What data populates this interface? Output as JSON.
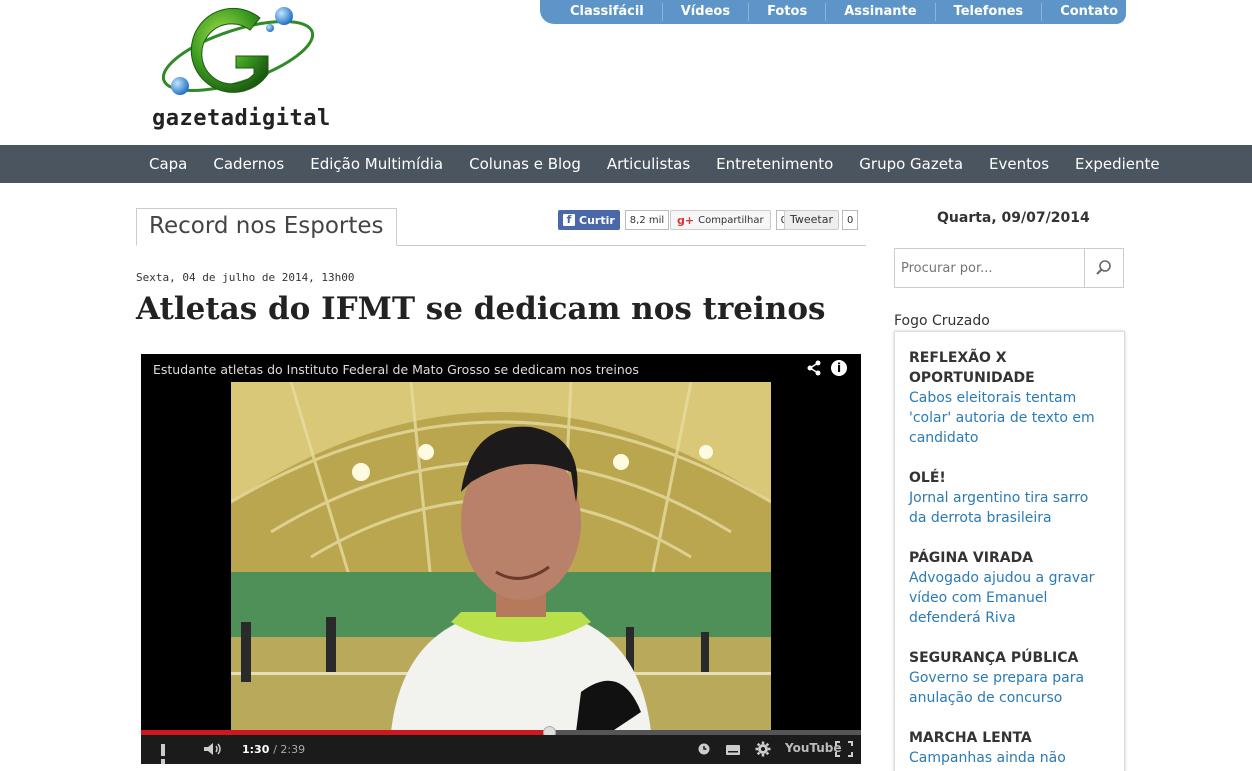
{
  "logo": {
    "text": "gazetadigital"
  },
  "top_menu": [
    "Classifácil",
    "Vídeos",
    "Fotos",
    "Assinante",
    "Telefones",
    "Contato"
  ],
  "main_nav": [
    "Capa",
    "Cadernos",
    "Edição Multimídia",
    "Colunas e Blog",
    "Articulistas",
    "Entretenimento",
    "Grupo Gazeta",
    "Eventos",
    "Expediente"
  ],
  "section": {
    "title": "Record nos Esportes"
  },
  "social": {
    "facebook_label": "Curtir",
    "facebook_count": "8,2 mil",
    "gplus_label": "Compartilhar",
    "gplus_count": "0",
    "twitter_label": "Tweetar",
    "twitter_count": "0"
  },
  "article": {
    "date": "Sexta, 04 de julho de 2014, 13h00",
    "headline": "Atletas do IFMT se dedicam nos treinos"
  },
  "video": {
    "title": "Estudante atletas do Instituto Federal de Mato Grosso se dedicam nos treinos",
    "current_time": "1:30",
    "duration": "/ 2:39",
    "progress": 0.566,
    "youtube_label": "YouTube"
  },
  "sidebar": {
    "date": "Quarta, 09/07/2014",
    "search_placeholder": "Procurar por...",
    "fogo_title": "Fogo Cruzado",
    "fogo_items": [
      {
        "kicker": "REFLEXÃO X OPORTUNIDADE",
        "link": "Cabos eleitorais tentam 'colar' autoria de texto em candidato"
      },
      {
        "kicker": "OLÉ!",
        "link": "Jornal argentino tira sarro da derrota brasileira"
      },
      {
        "kicker": "PÁGINA VIRADA",
        "link": "Advogado ajudou a gravar vídeo com Emanuel defenderá Riva"
      },
      {
        "kicker": "SEGURANÇA PÚBLICA",
        "link": "Governo se prepara para anulação de concurso"
      },
      {
        "kicker": "MARCHA LENTA",
        "link": "Campanhas ainda não"
      }
    ]
  }
}
